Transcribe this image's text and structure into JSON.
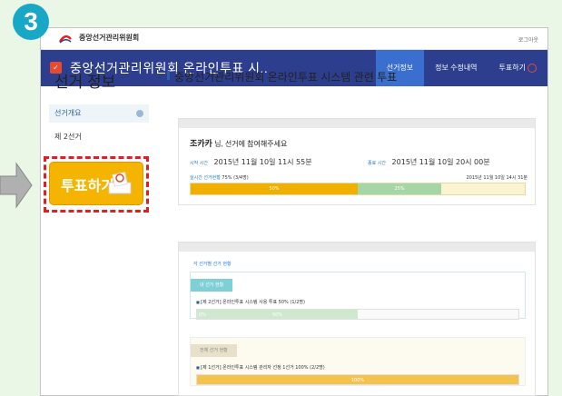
{
  "step_badge": "3",
  "topbar": {
    "org_name": "중앙선거관리위원회",
    "logout_label": "로그아웃"
  },
  "navbar": {
    "title": "중앙선거관리위원회 온라인투표 시..",
    "menu": [
      "선거정보",
      "정보 수정내역",
      "투표하기"
    ]
  },
  "sidebar": {
    "title": "선거 정보",
    "overview_label": "선거개요",
    "election_label": "제 2선거",
    "vote_button_label": "투표하기"
  },
  "main": {
    "title": "중앙선거관리위원회 온라인투표 시스템 관련 투표",
    "greeting_name": "조카카",
    "greeting_rest": "님, 선거에 참여해주세요",
    "start_label": "시작 시간",
    "start_time": "2015년 11월 10일 11시 55분",
    "end_label": "종료 시간",
    "end_time": "2015년 11월 10일 20시 00분",
    "rate_label": "실시간 선거현황",
    "rate_value": "75% (3/4명)",
    "rate_stamp": "2015년 11월 10일 14시 31분",
    "bar_seg1": "50%",
    "bar_seg2": "25%"
  },
  "sections": {
    "heading": "각 선거별 선거 현황",
    "my_tab": "내 선거 현황",
    "my_line": "[제 2선거] 온라인투표 시스템 사용 투표   50% (1/2명)",
    "my_bar_left": "0%",
    "my_bar_mid": "50%",
    "all_tab": "전체 선거 현황",
    "all_line": "[제 1선거] 온라인투표 시스템 관리자 선정 1선거   100% (2/2명)",
    "all_bar": "100%"
  },
  "progress": {
    "main_seg1": 0.5,
    "main_seg2": 0.25,
    "my_election": 0.5,
    "all_election": 1.0
  },
  "colors": {
    "navbar": "#2c3e8d",
    "accent_yellow": "#f0b000",
    "accent_green": "#a6d6a6",
    "badge": "#19a7c6"
  }
}
